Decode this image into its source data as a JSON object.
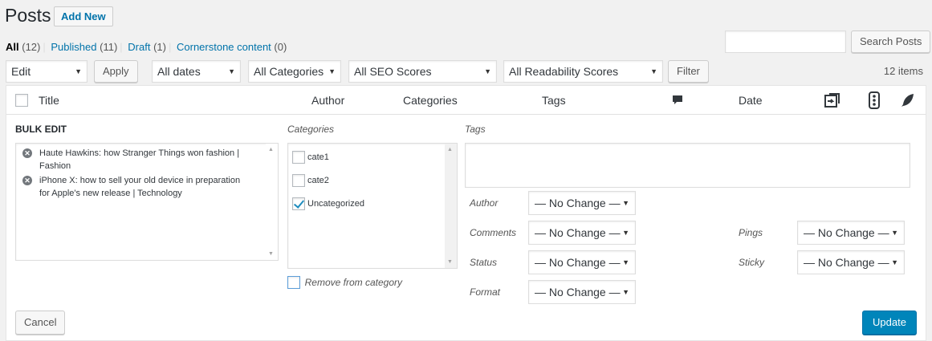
{
  "page": {
    "title": "Posts",
    "add_new_label": "Add New"
  },
  "views": [
    {
      "label": "All",
      "count": "(12)"
    },
    {
      "label": "Published",
      "count": "(11)"
    },
    {
      "label": "Draft",
      "count": "(1)"
    },
    {
      "label": "Cornerstone content",
      "count": "(0)"
    }
  ],
  "search": {
    "value": "",
    "button_label": "Search Posts"
  },
  "toolbar": {
    "bulk_action": "Edit",
    "apply_label": "Apply",
    "dates": "All dates",
    "categories": "All Categories",
    "seo_scores": "All SEO Scores",
    "readability_scores": "All Readability Scores",
    "filter_label": "Filter",
    "items_count": "12 items"
  },
  "columns": {
    "title": "Title",
    "author": "Author",
    "categories": "Categories",
    "tags": "Tags",
    "date": "Date"
  },
  "icons": {
    "comments": "comment-bubble-icon",
    "seo": "seo-links-icon",
    "readability": "traffic-light-icon",
    "feather": "feather-icon"
  },
  "bulk_edit": {
    "title": "BULK EDIT",
    "posts": [
      "Haute Hawkins: how Stranger Things won fashion | Fashion",
      "iPhone X: how to sell your old device in preparation for Apple's new release | Technology"
    ],
    "categories_legend": "Categories",
    "categories": [
      {
        "label": "cate1",
        "checked": false
      },
      {
        "label": "cate2",
        "checked": false
      },
      {
        "label": "Uncategorized",
        "checked": true
      }
    ],
    "remove_from_category": "Remove from category",
    "tags_legend": "Tags",
    "tags_value": "",
    "fields": {
      "author_label": "Author",
      "author_value": "— No Change —",
      "comments_label": "Comments",
      "comments_value": "— No Change —",
      "status_label": "Status",
      "status_value": "— No Change —",
      "format_label": "Format",
      "format_value": "— No Change —",
      "pings_label": "Pings",
      "pings_value": "— No Change —",
      "sticky_label": "Sticky",
      "sticky_value": "— No Change —"
    },
    "cancel_label": "Cancel",
    "update_label": "Update"
  },
  "colors": {
    "link": "#0073aa",
    "primary_button": "#0085ba",
    "checkmark": "#1e8cbe"
  }
}
